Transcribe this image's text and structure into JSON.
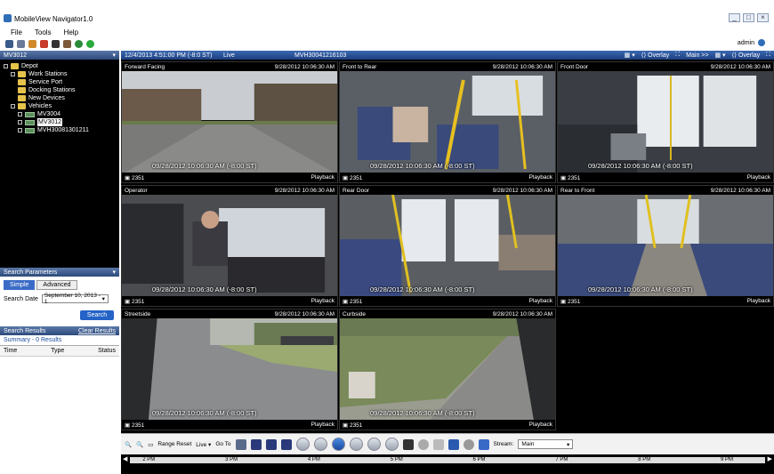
{
  "window": {
    "title": "MobileView Navigator1.0",
    "controls": [
      "_",
      "□",
      "×"
    ]
  },
  "menu": [
    "File",
    "Tools",
    "Help"
  ],
  "user": {
    "name": "admin"
  },
  "sidebar": {
    "vehicle_selector": "MV3012",
    "tree": [
      {
        "label": "Depot",
        "type": "folder",
        "level": 0
      },
      {
        "label": "Work Stations",
        "type": "folder",
        "level": 1
      },
      {
        "label": "Service Port",
        "type": "folder",
        "level": 1
      },
      {
        "label": "Docking Stations",
        "type": "folder",
        "level": 1
      },
      {
        "label": "New Devices",
        "type": "folder",
        "level": 1
      },
      {
        "label": "Vehicles",
        "type": "folder",
        "level": 1
      },
      {
        "label": "MV3004",
        "type": "vehicle",
        "level": 2
      },
      {
        "label": "MV3012",
        "type": "vehicle",
        "level": 2,
        "selected": true
      },
      {
        "label": "MVH30081301211",
        "type": "vehicle",
        "level": 2
      }
    ],
    "search_params": {
      "title": "Search Parameters",
      "tabs": [
        "Simple",
        "Advanced"
      ],
      "date_label": "Search Date",
      "date_value": "September 10, 2013 - 1",
      "search_button": "Search"
    },
    "search_results": {
      "title": "Search Results",
      "clear": "Clear Results",
      "summary": "Summary - 0 Results",
      "columns": [
        "Time",
        "Type",
        "Status"
      ]
    }
  },
  "main": {
    "header": {
      "datetime": "12/4/2013 4:51:00 PM (-8:0 ST)",
      "mode": "Live",
      "vehicle": "MVH30041216103",
      "overlay": "Overlay",
      "view": "Main >>",
      "overlay2": "Overlay"
    },
    "cameras": [
      {
        "name": "Forward Facing",
        "time": "9/28/2012 10:06:30 AM",
        "overlay": "09/28/2012 10:06:30 AM (-8:00 ST)",
        "id": "2351",
        "link": "Playback"
      },
      {
        "name": "Front to Rear",
        "time": "9/28/2012 10:06:30 AM",
        "overlay": "09/28/2012 10:06:30 AM (-8:00 ST)",
        "id": "2351",
        "link": "Playback"
      },
      {
        "name": "Front Door",
        "time": "9/28/2012 10:06:30 AM",
        "overlay": "09/28/2012 10:06:30 AM (-8:00 ST)",
        "id": "2351",
        "link": "Playback"
      },
      {
        "name": "Operator",
        "time": "9/28/2012 10:06:30 AM",
        "overlay": "09/28/2012 10:06:30 AM (-8:00 ST)",
        "id": "2351",
        "link": "Playback"
      },
      {
        "name": "Rear Door",
        "time": "9/28/2012 10:06:30 AM",
        "overlay": "09/28/2012 10:06:30 AM (-8:00 ST)",
        "id": "2351",
        "link": "Playback"
      },
      {
        "name": "Rear to Front",
        "time": "9/28/2012 10:06:30 AM",
        "overlay": "09/28/2012 10:06:30 AM (-8:00 ST)",
        "id": "2351",
        "link": "Playback"
      },
      {
        "name": "Streetside",
        "time": "9/28/2012 10:06:30 AM",
        "overlay": "09/28/2012 10:06:30 AM (-8:00 ST)",
        "id": "2351",
        "link": "Playback"
      },
      {
        "name": "Curbside",
        "time": "9/28/2012 10:06:30 AM",
        "overlay": "09/28/2012 10:06:30 AM (-8:00 ST)",
        "id": "2351",
        "link": "Playback"
      }
    ],
    "controls": {
      "range_reset": "Range Reset",
      "live": "Live",
      "goto": "Go To",
      "stream_label": "Stream:",
      "stream_value": "Main"
    },
    "timeline": [
      "2 PM",
      "3 PM",
      "4 PM",
      "5 PM",
      "6 PM",
      "7 PM",
      "8 PM",
      "9 PM"
    ]
  }
}
